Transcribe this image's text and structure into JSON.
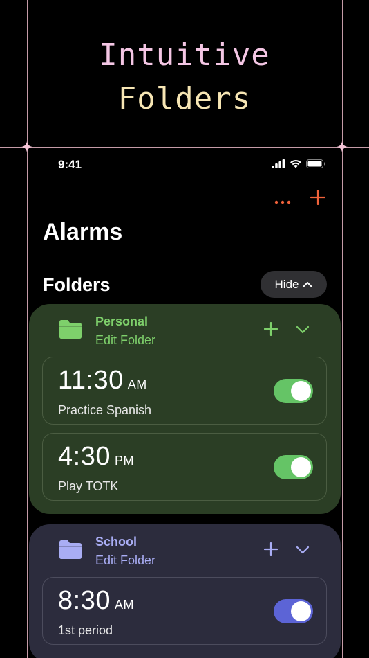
{
  "headline": {
    "line1": "Intuitive",
    "line2": "Folders"
  },
  "status": {
    "time": "9:41"
  },
  "toolbar": {
    "more_icon": "ellipsis-icon",
    "add_icon": "plus-icon"
  },
  "page": {
    "title": "Alarms",
    "folders_heading": "Folders",
    "hide_label": "Hide"
  },
  "colors": {
    "accent": "#f0623a",
    "personal": "#7ed06b",
    "school": "#a9adf4"
  },
  "folders": [
    {
      "name": "Personal",
      "edit_label": "Edit Folder",
      "alarms": [
        {
          "time": "11:30",
          "ampm": "AM",
          "label": "Practice Spanish",
          "enabled": true
        },
        {
          "time": "4:30",
          "ampm": "PM",
          "label": "Play TOTK",
          "enabled": true
        }
      ]
    },
    {
      "name": "School",
      "edit_label": "Edit Folder",
      "alarms": [
        {
          "time": "8:30",
          "ampm": "AM",
          "label": "1st period",
          "enabled": true
        }
      ]
    }
  ]
}
